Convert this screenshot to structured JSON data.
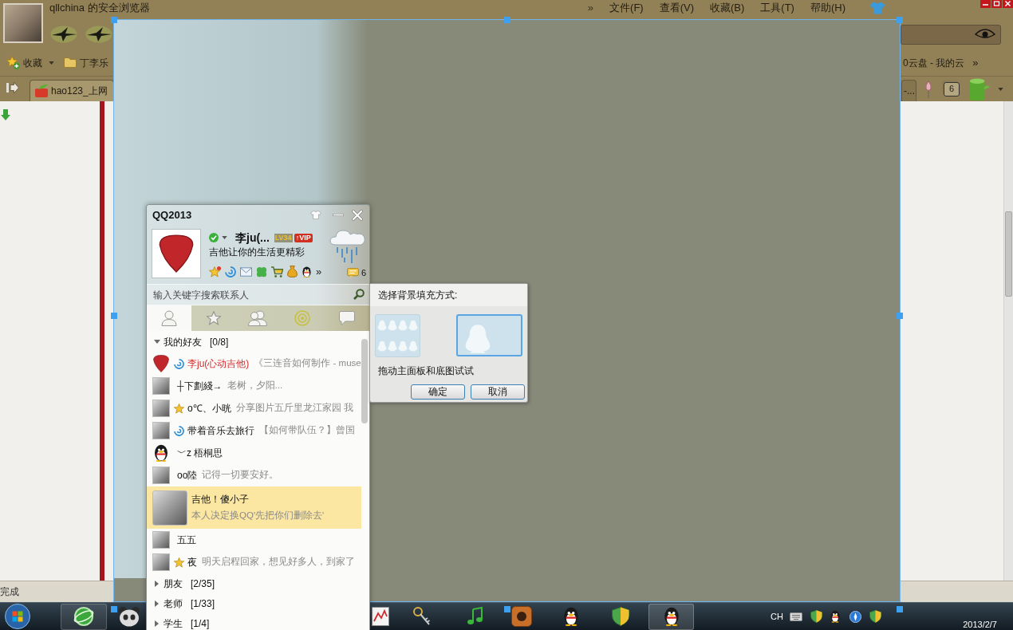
{
  "browser": {
    "title": "qllchina 的安全浏览器",
    "menu_overflow": "»",
    "menu": [
      "文件(F)",
      "查看(V)",
      "收藏(B)",
      "工具(T)",
      "帮助(H)"
    ],
    "bookmarks": [
      {
        "kind": "favorites",
        "label": "收藏"
      },
      {
        "kind": "folder",
        "label": "丁李乐"
      }
    ],
    "bookmarks_right": "0云盘 - 我的云",
    "bookmarks_overflow": "»",
    "tabs": [
      {
        "label": "hao123_上网",
        "selected": true
      },
      {
        "label": "-...",
        "selected": false
      }
    ],
    "tab_count": "6",
    "status": "完成"
  },
  "qq": {
    "title": "QQ2013",
    "online": true,
    "nickname": "李ju(...",
    "rank_badge": "LV34",
    "vip_badge": "↑VIP",
    "signature": "吉他让你的生活更精彩",
    "more": "»",
    "message_count": "6",
    "search": {
      "placeholder": "输入关键字搜索联系人"
    },
    "tabs": [
      {
        "selected": true
      },
      {
        "selected": false
      },
      {
        "selected": false
      },
      {
        "selected": false
      },
      {
        "selected": false
      }
    ],
    "groups": [
      {
        "name": "我的好友",
        "count": "[0/8]",
        "expanded": true,
        "children": [
          {
            "name": "李ju(心动吉他)",
            "note": "《三连音如何制作 - muse",
            "avatar": {
              "kind": "pick"
            },
            "badge": {
              "kind": "music"
            },
            "vip": true,
            "selected": false
          },
          {
            "name": "┼下劃綫→",
            "note": "老树，夕阳...",
            "avatar": {
              "kind": "photo"
            },
            "vip": false,
            "selected": false
          },
          {
            "name": "o℃、小晄",
            "note": "分享图片五斤里龙江家园 我",
            "avatar": {
              "kind": "photo"
            },
            "badge": {
              "kind": "star"
            },
            "vip": false,
            "selected": false
          },
          {
            "name": "带着音乐去旅行",
            "note": "【如何带队伍？】曾国",
            "avatar": {
              "kind": "photo"
            },
            "badge": {
              "kind": "music"
            },
            "vip": false,
            "selected": false
          },
          {
            "name": "﹀z 梧桐思",
            "avatar": {
              "kind": "penguin"
            },
            "vip": false,
            "selected": false
          },
          {
            "name": "oo陸",
            "note": "记得一切要安好。",
            "avatar": {
              "kind": "photo"
            },
            "vip": false,
            "selected": false
          },
          {
            "name": "吉他！傻小子",
            "note": "本人决定换QQ'先把你们删除去'",
            "avatar": {
              "kind": "photo"
            },
            "vip": false,
            "selected": true
          },
          {
            "name": "五五",
            "avatar": {
              "kind": "photo"
            },
            "vip": false,
            "selected": false
          },
          {
            "name": "夜",
            "note": "明天启程回家，想见好多人，到家了",
            "avatar": {
              "kind": "photo"
            },
            "badge": {
              "kind": "star"
            },
            "vip": false,
            "selected": false
          }
        ]
      },
      {
        "name": "朋友",
        "count": "[2/35]",
        "expanded": false
      },
      {
        "name": "老师",
        "count": "[1/33]",
        "expanded": false
      },
      {
        "name": "学生",
        "count": "[1/4]",
        "expanded": false
      }
    ]
  },
  "dialog": {
    "title": "选择背景填充方式:",
    "options": [
      {
        "kind": "tile",
        "selected": false
      },
      {
        "kind": "stretch",
        "selected": true
      }
    ],
    "hint": "拖动主面板和底图试试",
    "buttons": [
      "确定",
      "取消"
    ]
  },
  "taskbar": {
    "language": "CH",
    "date": "2013/2/7"
  }
}
